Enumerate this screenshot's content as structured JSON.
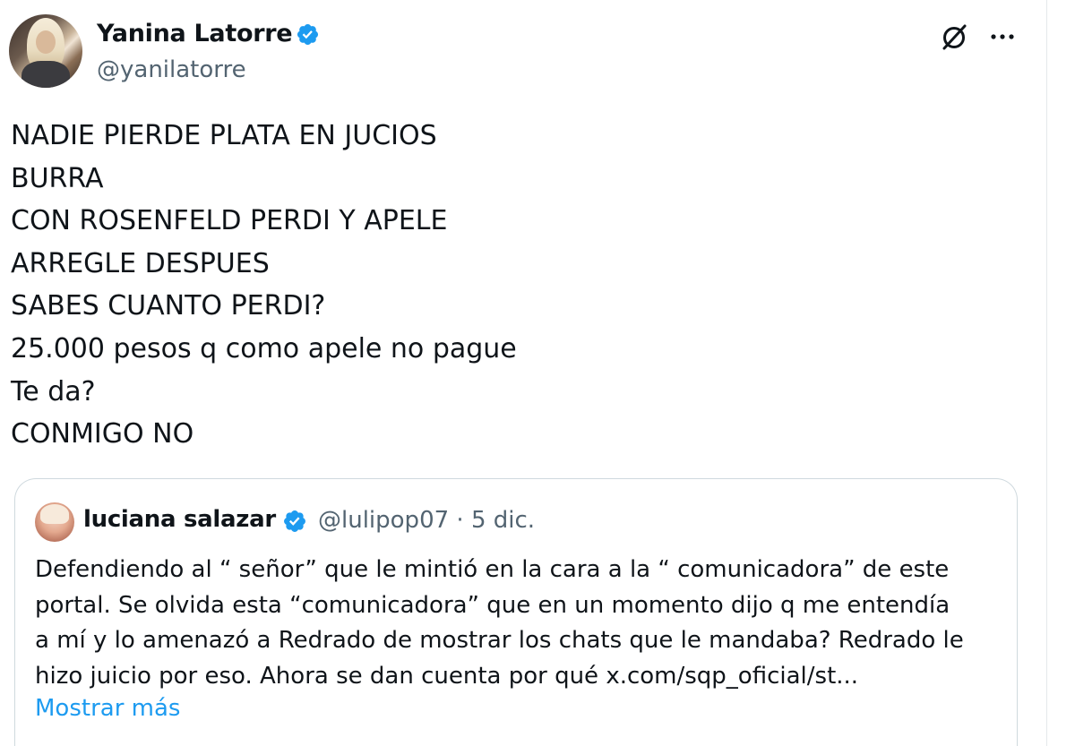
{
  "author": {
    "display_name": "Yanina Latorre",
    "handle": "@yanilatorre",
    "verified": true
  },
  "actions": {
    "grok_icon": "grok-icon",
    "more_icon": "more-icon",
    "more_label": "···"
  },
  "tweet": {
    "lines": [
      "NADIE PIERDE PLATA EN JUCIOS",
      "BURRA",
      "CON ROSENFELD PERDI Y APELE",
      "ARREGLE DESPUES",
      "SABES CUANTO PERDI?",
      "25.000 pesos q como apele no pague",
      "Te da?",
      "CONMIGO NO"
    ]
  },
  "quote": {
    "display_name": "luciana salazar",
    "verified": true,
    "meta": "@lulipop07 · 5 dic.",
    "lines": [
      "Defendiendo al “ señor”  que le mintió en la cara a la “ comunicadora” de este",
      "portal. Se olvida esta “comunicadora” que en un momento dijo q me entendía",
      "a mí y lo amenazó a Redrado de mostrar los chats que le mandaba? Redrado le",
      "hizo juicio por eso.  Ahora se dan cuenta por qué x.com/sqp_oficial/st..."
    ],
    "show_more": "Mostrar más"
  },
  "colors": {
    "text": "#0f1419",
    "secondary": "#536471",
    "accent": "#1d9bf0",
    "border": "#cfd9de"
  }
}
